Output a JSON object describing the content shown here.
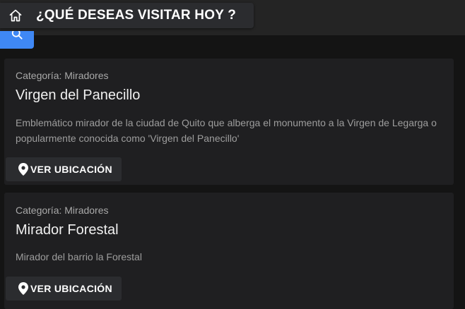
{
  "header": {
    "title": "¿QUÉ DESEAS VISITAR HOY ?",
    "home_icon": "home-icon",
    "search_icon": "search-icon",
    "search_button_color": "#3f88f5"
  },
  "places": [
    {
      "category": "Categoría: Miradores",
      "name": "Virgen del Panecillo",
      "description_line1": "Emblemático mirador de la ciudad de Quito que alberga el monumento a la Virgen de Legarga o",
      "description_line2": "popularmente conocida como 'Virgen del Panecillo'",
      "button_label": "VER UBICACIÓN",
      "button_icon": "location-pin-icon"
    },
    {
      "category": "Categoría: Miradores",
      "name": "Mirador Forestal",
      "description_line1": "Mirador del barrio la Forestal",
      "button_label": "VER UBICACIÓN",
      "button_icon": "location-pin-icon"
    }
  ]
}
